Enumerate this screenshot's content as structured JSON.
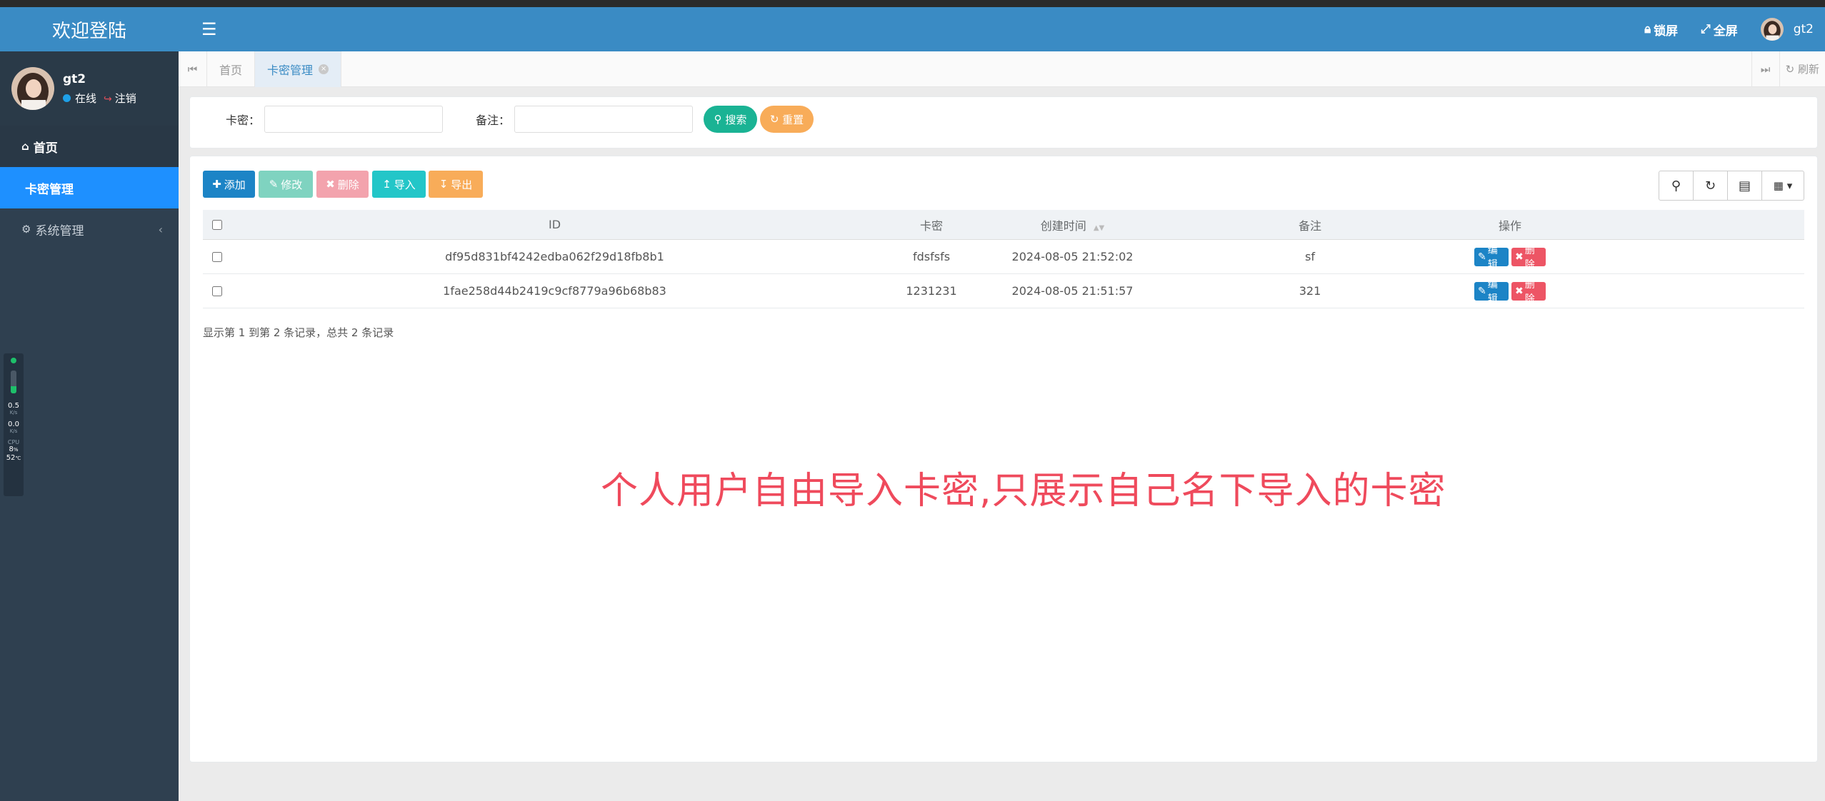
{
  "sidebar": {
    "brand": "欢迎登陆",
    "user": {
      "name": "gt2",
      "status_online": "在线",
      "logout": "注销"
    },
    "nav": [
      {
        "label": "首页",
        "icon": "home-icon"
      },
      {
        "label": "卡密管理"
      },
      {
        "label": "系统管理",
        "icon": "gear-icon"
      }
    ]
  },
  "monitor": {
    "up_value": "0.5",
    "up_unit": "K/s",
    "down_value": "0.0",
    "down_unit": "K/s",
    "cpu_label": "CPU",
    "cpu_value": "8",
    "cpu_unit": "%",
    "temp_value": "52",
    "temp_unit": "℃",
    "memory_level": 0.3
  },
  "header": {
    "lock_label": "锁屏",
    "fullscreen_label": "全屏",
    "username": "gt2"
  },
  "tabs": {
    "items": [
      {
        "label": "首页"
      },
      {
        "label": "卡密管理"
      }
    ],
    "refresh_label": "刷新"
  },
  "search": {
    "card_label": "卡密：",
    "note_label": "备注：",
    "card_value": "",
    "note_value": "",
    "search_button": "搜索",
    "reset_button": "重置"
  },
  "toolbar": {
    "add": "添加",
    "edit": "修改",
    "delete": "删除",
    "import": "导入",
    "export": "导出"
  },
  "table": {
    "columns": [
      "ID",
      "卡密",
      "创建时间",
      "备注",
      "操作"
    ],
    "rows": [
      {
        "id": "df95d831bf4242edba062f29d18fb8b1",
        "card": "fdsfsfs",
        "created": "2024-08-05 21:52:02",
        "note": "sf"
      },
      {
        "id": "1fae258d44b2419c9cf8779a96b68b83",
        "card": "1231231",
        "created": "2024-08-05 21:51:57",
        "note": "321"
      }
    ],
    "row_edit": "编辑",
    "row_delete": "删除",
    "summary": "显示第 1 到第 2 条记录，总共 2 条记录"
  },
  "watermark": "个人用户自由导入卡密,只展示自己名下导入的卡密",
  "colors": {
    "header_blue": "#3a8bc4",
    "sidebar_dark": "#2f4050",
    "active_nav": "#1e90ff",
    "search_green": "#1ab394",
    "reset_orange": "#f8ac59",
    "add_blue": "#1c84c6",
    "import_cyan": "#23c6c8",
    "delete_red": "#ed5565",
    "watermark_red": "#ef4a5c"
  }
}
